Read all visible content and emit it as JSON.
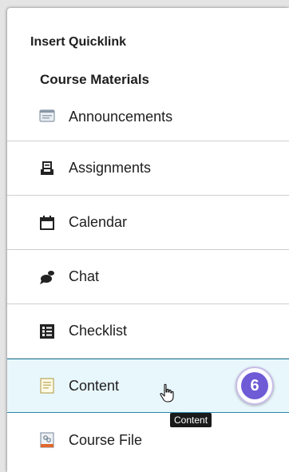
{
  "dialog": {
    "title": "Insert Quicklink"
  },
  "section": {
    "title": "Course Materials"
  },
  "items": [
    {
      "label": "Announcements",
      "icon": "announcements-icon"
    },
    {
      "label": "Assignments",
      "icon": "assignments-icon"
    },
    {
      "label": "Calendar",
      "icon": "calendar-icon"
    },
    {
      "label": "Chat",
      "icon": "chat-icon"
    },
    {
      "label": "Checklist",
      "icon": "checklist-icon"
    },
    {
      "label": "Content",
      "icon": "content-icon"
    },
    {
      "label": "Course File",
      "icon": "course-file-icon"
    }
  ],
  "step_badge": {
    "number": "6",
    "color": "#6f5bd6"
  },
  "tooltip": {
    "text": "Content"
  },
  "colors": {
    "highlight_bg": "#e8f7fc",
    "highlight_border": "#2a87a6"
  }
}
